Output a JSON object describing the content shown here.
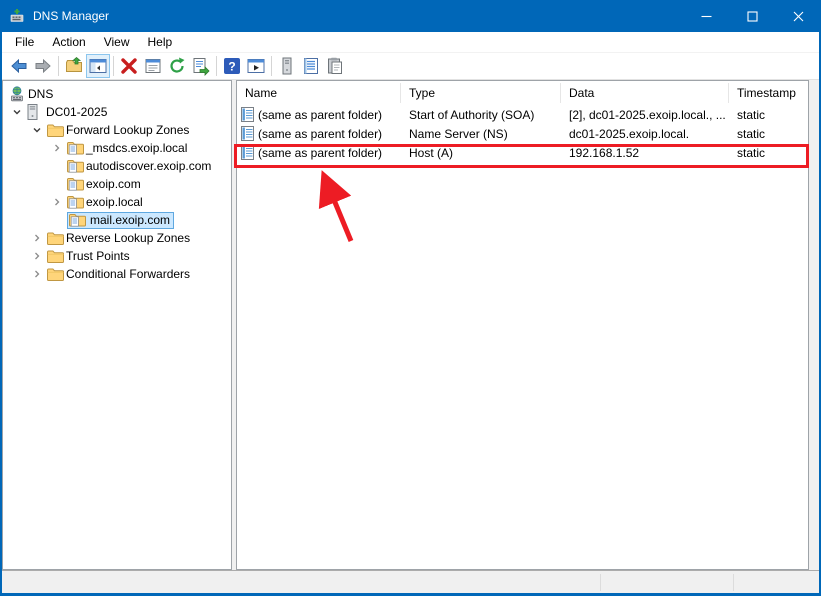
{
  "titlebar": {
    "title": "DNS Manager"
  },
  "menubar": {
    "items": [
      "File",
      "Action",
      "View",
      "Help"
    ]
  },
  "toolbar": {
    "icons": [
      "back-icon",
      "forward-icon",
      "show-parent-icon",
      "console-tree-toggle-icon",
      "delete-icon",
      "properties-icon",
      "refresh-icon",
      "export-list-icon",
      "help-icon",
      "new-window-icon",
      "server-icon",
      "record-list-icon",
      "paste-icon"
    ]
  },
  "tree": {
    "items": [
      {
        "label": "DNS"
      },
      {
        "label": "DC01-2025"
      },
      {
        "label": "Forward Lookup Zones"
      },
      {
        "label": "_msdcs.exoip.local"
      },
      {
        "label": "autodiscover.exoip.com"
      },
      {
        "label": "exoip.com"
      },
      {
        "label": "exoip.local"
      },
      {
        "label": "mail.exoip.com"
      },
      {
        "label": "Reverse Lookup Zones"
      },
      {
        "label": "Trust Points"
      },
      {
        "label": "Conditional Forwarders"
      }
    ],
    "selected": "mail.exoip.com"
  },
  "records": {
    "columns": [
      "Name",
      "Type",
      "Data",
      "Timestamp"
    ],
    "rows": [
      {
        "name": "(same as parent folder)",
        "type": "Start of Authority (SOA)",
        "data": "[2], dc01-2025.exoip.local., ...",
        "timestamp": "static"
      },
      {
        "name": "(same as parent folder)",
        "type": "Name Server (NS)",
        "data": "dc01-2025.exoip.local.",
        "timestamp": "static"
      },
      {
        "name": "(same as parent folder)",
        "type": "Host (A)",
        "data": "192.168.1.52",
        "timestamp": "static"
      }
    ]
  },
  "colors": {
    "titlebar_blue": "#0067B8",
    "selection_bg": "#CCE8FF",
    "selection_border": "#5FA8E0",
    "annotation_red": "#ED1C24"
  }
}
